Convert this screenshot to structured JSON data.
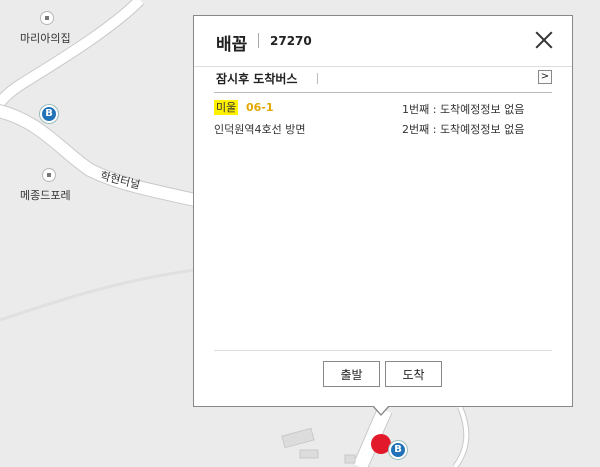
{
  "map": {
    "places": [
      {
        "name": "마리아의집"
      },
      {
        "name": "메종드포레"
      }
    ],
    "road_label": "학현터널",
    "bus_icon_text": "B",
    "colors": {
      "bus_marker": "#2272b8",
      "selected_pin": "#e2192b",
      "road": "#ffffff",
      "background": "#ebebeb"
    }
  },
  "popup": {
    "stop_name": "배꼽",
    "stop_id": "27270",
    "close_icon": "close-icon",
    "section_title": "잠시후 도착버스",
    "next_icon": ">",
    "routes": [
      {
        "type": "미울",
        "number": "06-1",
        "direction": "인덕원역4호선 방면",
        "arrival_1": "1번째 : 도착예정정보 없음",
        "arrival_2": "2번째 : 도착예정정보 없음"
      }
    ],
    "buttons": {
      "depart": "출발",
      "arrive": "도착"
    },
    "colors": {
      "route_type_bg": "#fff100",
      "route_number": "#e3a800"
    }
  }
}
